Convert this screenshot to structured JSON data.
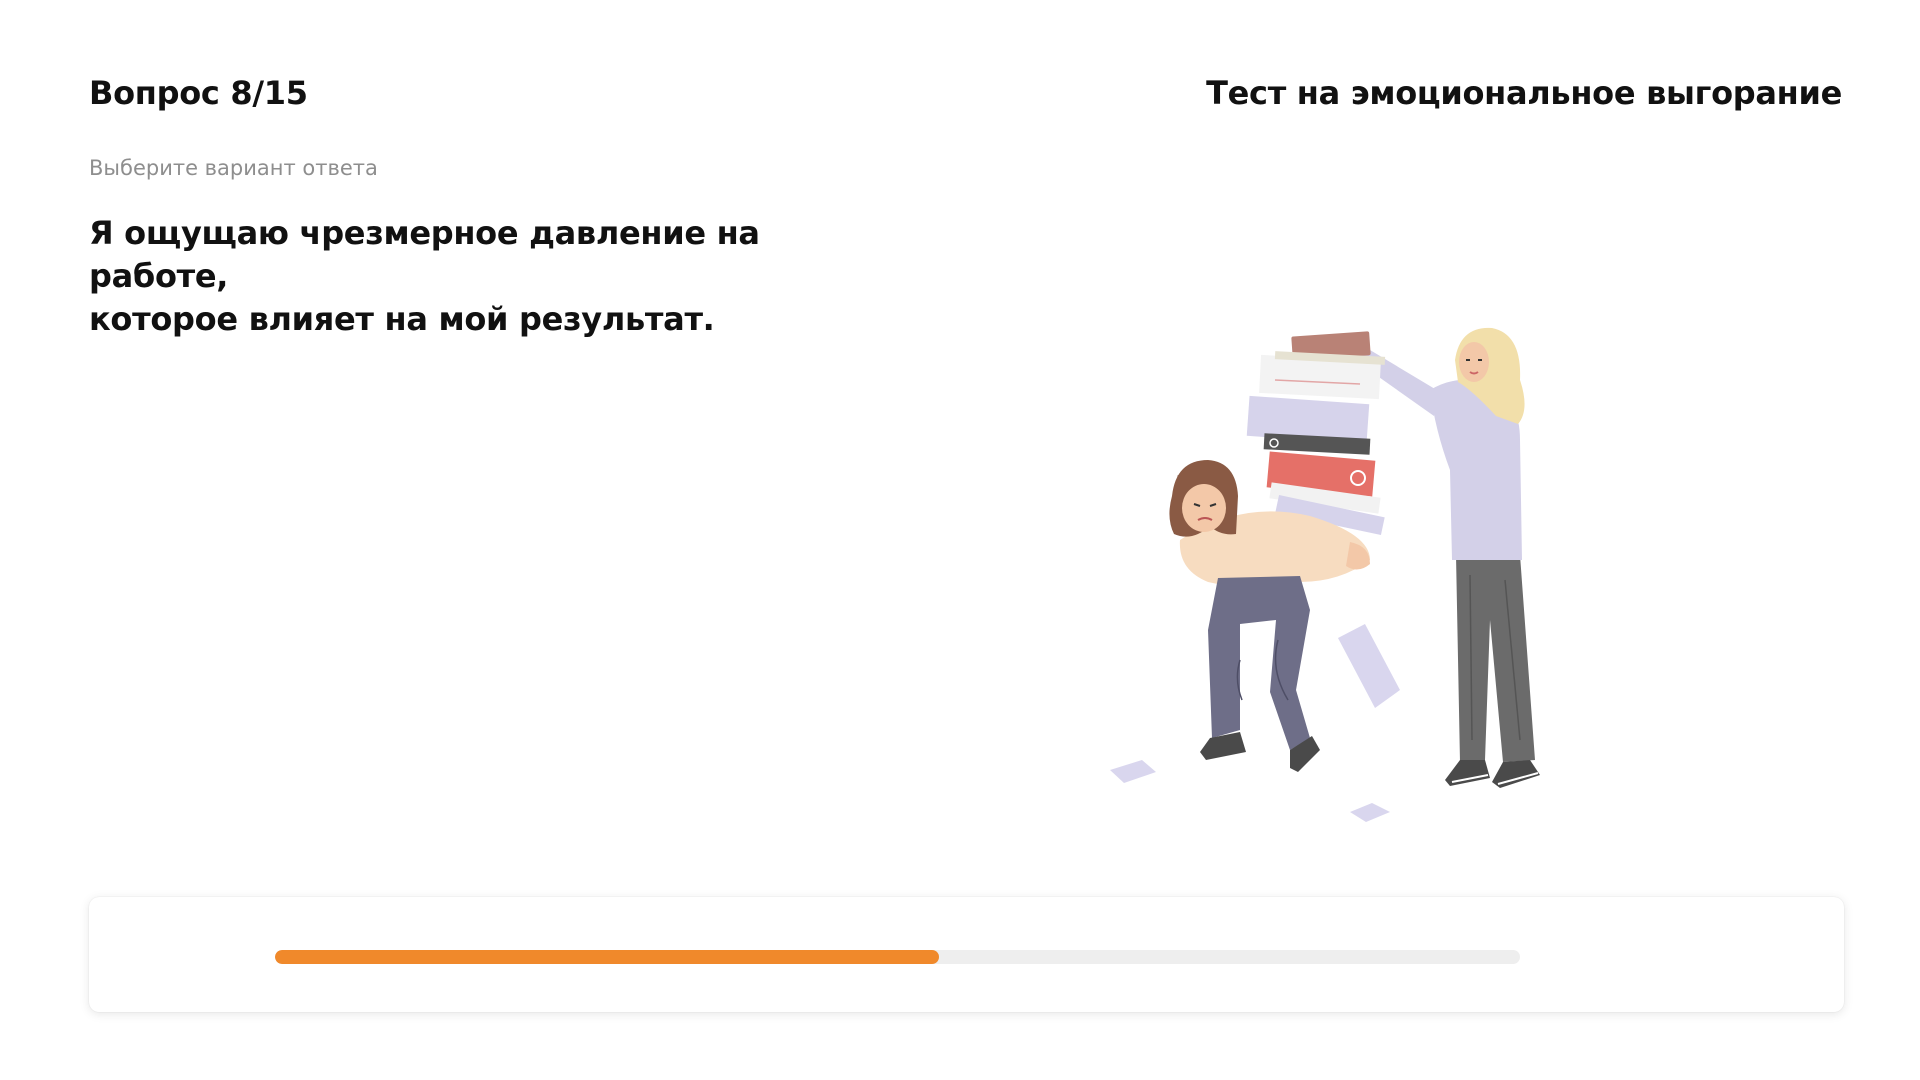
{
  "header": {
    "question_counter": "Вопрос 8/15",
    "test_title": "Тест на эмоциональное выгорание"
  },
  "question": {
    "hint": "Выберите вариант ответа",
    "line1": "Я ощущаю чрезмерное давление на работе,",
    "line2": "которое влияет на мой результат."
  },
  "illustration": {
    "icon": "stress-at-work-illustration"
  },
  "progress": {
    "fraction": 0.5333,
    "fill_color": "#F0892B",
    "track_color": "#EEEEEE"
  }
}
